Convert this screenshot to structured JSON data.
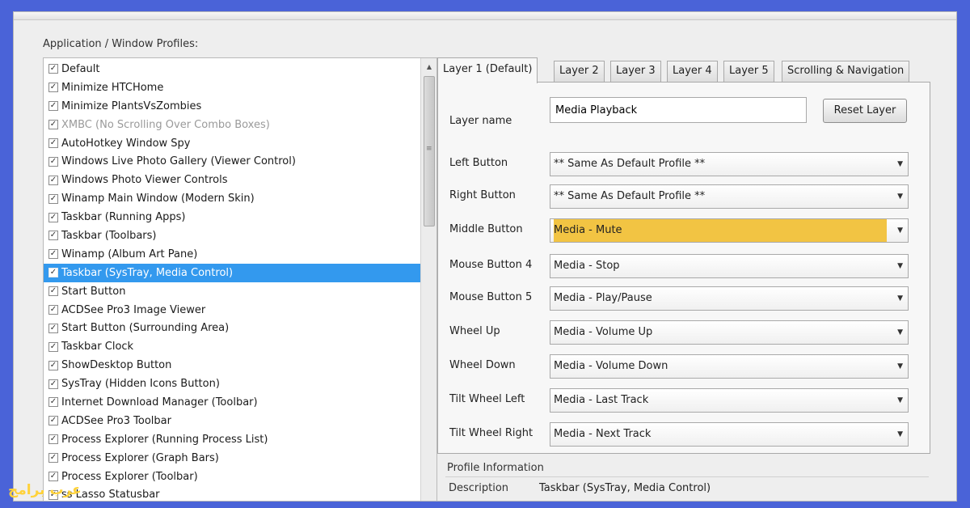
{
  "group_title": "Application / Window Profiles:",
  "profiles": [
    {
      "label": "Default",
      "checked": true,
      "selected": false,
      "disabled": false
    },
    {
      "label": "Minimize HTCHome",
      "checked": true,
      "selected": false,
      "disabled": false
    },
    {
      "label": "Minimize PlantsVsZombies",
      "checked": true,
      "selected": false,
      "disabled": false
    },
    {
      "label": "XMBC (No Scrolling Over Combo Boxes)",
      "checked": true,
      "selected": false,
      "disabled": true
    },
    {
      "label": "AutoHotkey Window Spy",
      "checked": true,
      "selected": false,
      "disabled": false
    },
    {
      "label": "Windows Live Photo Gallery (Viewer Control)",
      "checked": true,
      "selected": false,
      "disabled": false
    },
    {
      "label": "Windows Photo Viewer Controls",
      "checked": true,
      "selected": false,
      "disabled": false
    },
    {
      "label": "Winamp Main Window (Modern Skin)",
      "checked": true,
      "selected": false,
      "disabled": false
    },
    {
      "label": "Taskbar (Running Apps)",
      "checked": true,
      "selected": false,
      "disabled": false
    },
    {
      "label": "Taskbar (Toolbars)",
      "checked": true,
      "selected": false,
      "disabled": false
    },
    {
      "label": "Winamp (Album Art Pane)",
      "checked": true,
      "selected": false,
      "disabled": false
    },
    {
      "label": "Taskbar (SysTray, Media Control)",
      "checked": true,
      "selected": true,
      "disabled": false
    },
    {
      "label": "Start Button",
      "checked": true,
      "selected": false,
      "disabled": false
    },
    {
      "label": "ACDSee Pro3 Image Viewer",
      "checked": true,
      "selected": false,
      "disabled": false
    },
    {
      "label": "Start Button (Surrounding Area)",
      "checked": true,
      "selected": false,
      "disabled": false
    },
    {
      "label": "Taskbar Clock",
      "checked": true,
      "selected": false,
      "disabled": false
    },
    {
      "label": "ShowDesktop Button",
      "checked": true,
      "selected": false,
      "disabled": false
    },
    {
      "label": "SysTray (Hidden Icons Button)",
      "checked": true,
      "selected": false,
      "disabled": false
    },
    {
      "label": "Internet Download Manager (Toolbar)",
      "checked": true,
      "selected": false,
      "disabled": false
    },
    {
      "label": "ACDSee Pro3 Toolbar",
      "checked": true,
      "selected": false,
      "disabled": false
    },
    {
      "label": "Process Explorer (Running Process List)",
      "checked": true,
      "selected": false,
      "disabled": false
    },
    {
      "label": "Process Explorer (Graph Bars)",
      "checked": true,
      "selected": false,
      "disabled": false
    },
    {
      "label": "Process Explorer (Toolbar)",
      "checked": true,
      "selected": false,
      "disabled": false
    },
    {
      "label": "ss Lasso Statusbar",
      "checked": true,
      "selected": false,
      "disabled": false
    }
  ],
  "checkmark_glyph": "✓",
  "tabs": [
    "Layer 1 (Default)",
    "Layer 2",
    "Layer 3",
    "Layer 4",
    "Layer 5",
    "Scrolling & Navigation"
  ],
  "layer": {
    "name_label": "Layer name",
    "name_value": "Media Playback",
    "reset_label": "Reset Layer",
    "fields": [
      {
        "label": "Left Button",
        "value": "** Same As Default Profile **",
        "highlighted": false
      },
      {
        "label": "Right Button",
        "value": "** Same As Default Profile **",
        "highlighted": false
      },
      {
        "label": "Middle Button",
        "value": "Media - Mute",
        "highlighted": true
      },
      {
        "label": "Mouse Button 4",
        "value": "Media - Stop",
        "highlighted": false
      },
      {
        "label": "Mouse Button 5",
        "value": "Media - Play/Pause",
        "highlighted": false
      },
      {
        "label": "Wheel Up",
        "value": "Media - Volume Up",
        "highlighted": false
      },
      {
        "label": "Wheel Down",
        "value": "Media - Volume Down",
        "highlighted": false
      },
      {
        "label": "Tilt Wheel Left",
        "value": "Media - Last Track",
        "highlighted": false
      },
      {
        "label": "Tilt Wheel Right",
        "value": "Media - Next Track",
        "highlighted": false
      }
    ]
  },
  "profile_info": {
    "title": "Profile Information",
    "description_label": "Description",
    "description_value": "Taskbar (SysTray, Media Control)"
  },
  "watermark": "عرب برامج",
  "colors": {
    "background": "#4a63d8",
    "selection": "#3399ee",
    "highlight": "#f1c74a",
    "watermark": "#ffd23a"
  }
}
